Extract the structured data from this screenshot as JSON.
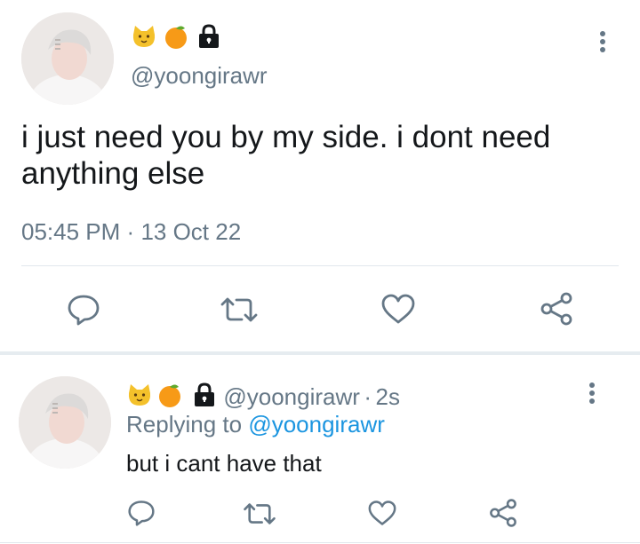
{
  "main_tweet": {
    "handle": "@yoongirawr",
    "name_icons": [
      "cat-face-icon",
      "tangerine-icon",
      "lock-icon"
    ],
    "text_line1": "i just need you by my side. i dont need",
    "text_line2": "anything else",
    "time": "05:45 PM",
    "separator": "·",
    "date": "13 Oct 22",
    "actions": [
      "reply-icon",
      "retweet-icon",
      "like-icon",
      "share-icon"
    ]
  },
  "reply_tweet": {
    "handle": "@yoongirawr",
    "separator": "·",
    "age": "2s",
    "replying_to_label": "Replying to",
    "replying_to_handle": "@yoongirawr",
    "text": "but i cant have that",
    "actions": [
      "reply-icon",
      "retweet-icon",
      "like-icon",
      "share-icon"
    ]
  },
  "colors": {
    "text": "#14171a",
    "muted": "#657786",
    "link": "#1b95e0",
    "divider": "#e1e8ed",
    "icon": "#657786"
  }
}
